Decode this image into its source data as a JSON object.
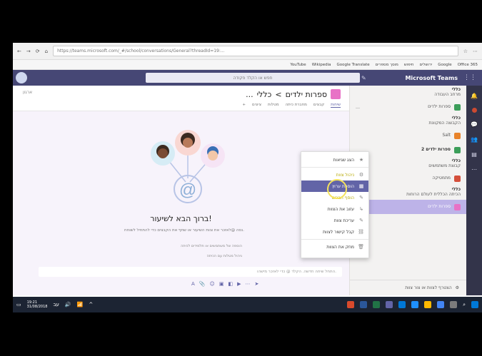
{
  "browser": {
    "url": "https://teams.microsoft.com/_#/school/conversations/General?threadId=19:...",
    "bookmarks": [
      "Office 365",
      "Google",
      "ירושלים",
      "חיפוש",
      "מוסך מספרים",
      "Google Translate",
      "Wikipedia",
      "YouTube"
    ]
  },
  "teams": {
    "brand": "Microsoft Teams",
    "search_placeholder": "חפש או הקלד פקודה"
  },
  "header": {
    "team_name": "ספרות ילדים",
    "separator": ">",
    "channel": "כללי",
    "more": "...",
    "org_label": "ארגון",
    "tabs": [
      "שיחות",
      "קבצים",
      "מחברת כיתה",
      "מטלות",
      "ציונים",
      "+"
    ]
  },
  "welcome": {
    "title": "ברוך הבא לשיעור!",
    "subtitle": "נסה @לאזכר את צוות השיעור או שתף את הקבצים כדי להתחיל לשוחח.",
    "hint1": "הוספה של משתמשים או תלמידים לכיתה",
    "hint2": "ניהול מטלות עם הכיתה",
    "composer_placeholder": "התחל שיחה חדשה. הקלד @ כדי לאזכר מישהו."
  },
  "channels": [
    {
      "label": "כללי",
      "sub": "מרחב העבודה",
      "color": ""
    },
    {
      "label": "ספרות ילדים",
      "sub": "",
      "color": "#3c9e5a"
    },
    {
      "label": "כללי",
      "sub": "הקבוצה המקוונת",
      "color": ""
    },
    {
      "label": "Salt",
      "sub": "",
      "color": "#e8832a"
    },
    {
      "label": "ספרות ילדים 2",
      "sub": "",
      "color": "#3c9e5a"
    },
    {
      "label": "כללי",
      "sub": "קבוצת משתמשים",
      "color": ""
    },
    {
      "label": "מתמטיקה",
      "sub": "",
      "color": "#d44f3b"
    },
    {
      "label": "כללי",
      "sub": "הכיתה הכללית לעולם הרוחות",
      "color": ""
    },
    {
      "label": "ספרות ילדים",
      "sub": "",
      "color": "#e872c6"
    }
  ],
  "channels_footer": "הצטרף לצוות או צור צוות",
  "menu": {
    "items": [
      {
        "label": "הצג שגיאות",
        "icon": "star-icon"
      },
      {
        "label": "ניהול צוות",
        "icon": "gear-icon"
      },
      {
        "label": "הוספת ערוץ",
        "icon": "add-channel-icon"
      },
      {
        "label": "הוסף חברים",
        "icon": "add-member-icon"
      },
      {
        "label": "עזוב את הצוות",
        "icon": "leave-icon"
      },
      {
        "label": "עריכת צוות",
        "icon": "edit-icon"
      },
      {
        "label": "קבל קישור לצוות",
        "icon": "link-icon"
      },
      {
        "label": "מחק את הצוות",
        "icon": "trash-icon"
      }
    ],
    "highlighted_index": 2
  },
  "taskbar": {
    "time": "19:21",
    "date": "31/08/2018",
    "lang": "עב"
  }
}
